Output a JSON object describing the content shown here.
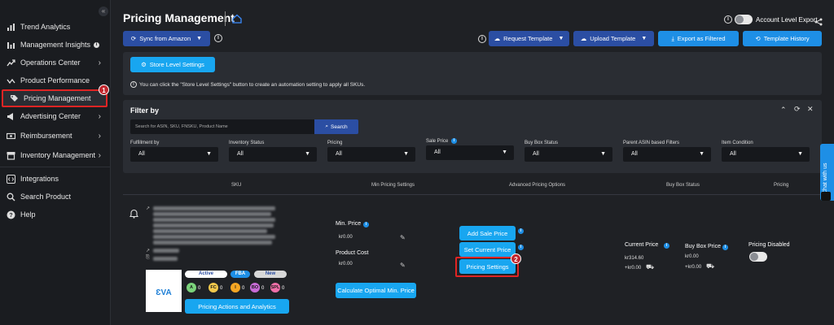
{
  "sidebar": {
    "items": [
      {
        "label": "Trend Analytics"
      },
      {
        "label": "Management Insights"
      },
      {
        "label": "Operations Center"
      },
      {
        "label": "Product Performance"
      },
      {
        "label": "Pricing Management"
      },
      {
        "label": "Advertising Center"
      },
      {
        "label": "Reimbursement"
      },
      {
        "label": "Inventory Management"
      },
      {
        "label": "Integrations"
      },
      {
        "label": "Search Product"
      },
      {
        "label": "Help"
      }
    ],
    "collapse_glyph": "«"
  },
  "markers": {
    "one": "1",
    "two": "2"
  },
  "header": {
    "title": "Pricing Management",
    "account_level_export": "Account Level Export",
    "sync_button": "Sync from Amazon",
    "request_template": "Request Template",
    "upload_template": "Upload Template",
    "export_filtered": "Export as Filtered",
    "template_history": "Template History"
  },
  "store": {
    "button": "Store Level Settings",
    "note": "You can click the \"Store Level Settings\" button to create an automation setting to apply all SKUs."
  },
  "filter": {
    "title": "Filter by",
    "search_placeholder": "Search for ASIN, SKU, FNSKU, Product Name",
    "search_button": "Search",
    "fields": [
      {
        "label": "Fulfillment by",
        "value": "All"
      },
      {
        "label": "Inventory Status",
        "value": "All"
      },
      {
        "label": "Pricing",
        "value": "All"
      },
      {
        "label": "Sale Price",
        "value": "All"
      },
      {
        "label": "Buy Box Status",
        "value": "All"
      },
      {
        "label": "Parent ASIN based Filters",
        "value": "All"
      },
      {
        "label": "Item Condition",
        "value": "All"
      }
    ]
  },
  "table": {
    "headers": [
      "SKU",
      "Min Pricing Settings",
      "Advanced Pricing Options",
      "Buy Box Status",
      "Pricing"
    ],
    "row": {
      "badges": {
        "active": "Active",
        "fba": "FBA",
        "new": "New"
      },
      "circles": [
        {
          "letter": "A",
          "count": "0",
          "color": "#7bd37b"
        },
        {
          "letter": "FC",
          "count": "0",
          "color": "#f2c94c"
        },
        {
          "letter": "I",
          "count": "0",
          "color": "#f5a623"
        },
        {
          "letter": "BO",
          "count": "0",
          "color": "#c86bd6"
        },
        {
          "letter": "SPL",
          "count": "0",
          "color": "#f06fa8"
        }
      ],
      "actions_button": "Pricing Actions and Analytics",
      "min_price_label": "Min. Price",
      "min_price_value": "kr0.00",
      "product_cost_label": "Product Cost",
      "product_cost_value": "kr0.00",
      "calc_button": "Calculate Optimal Min. Price",
      "add_sale_price": "Add Sale Price",
      "set_current_price": "Set Current Price",
      "pricing_settings": "Pricing Settings",
      "current_price_label": "Current Price",
      "current_price_value": "kr314.60",
      "current_price_ship": "+kr0.00",
      "buy_box_label": "Buy Box Price",
      "buy_box_value": "kr0.00",
      "buy_box_ship": "+kr0.00",
      "pricing_disabled": "Pricing Disabled",
      "logo_text": "ƐVA"
    }
  },
  "chat": {
    "label": "Chat with us"
  },
  "colors": {
    "accent": "#1e8fe6",
    "navy": "#2b4ea3",
    "highlight": "#e02424"
  }
}
